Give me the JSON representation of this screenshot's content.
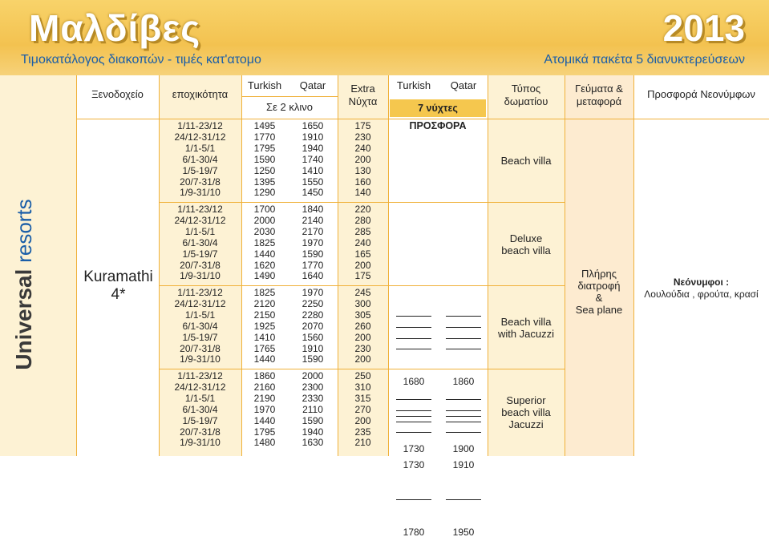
{
  "header": {
    "title": "Μαλδίβες",
    "year": "2013",
    "subtitle_left": "Τιμοκατάλογος διακοπών - τιμές κατ'ατομο",
    "subtitle_right": "Ατομικά πακέτα 5 διανυκτερεύσεων"
  },
  "side_title": {
    "main": "Universal",
    "rest": "resorts"
  },
  "columns": {
    "hotel": "Ξενοδοχείο",
    "season": "εποχικότητα",
    "turkish": "Turkish",
    "qatar": "Qatar",
    "double": "Σε 2 κλινο",
    "extra": "Extra\nΝύχτα",
    "offer_turkish": "Turkish",
    "offer_qatar": "Qatar",
    "offer_label": "7 νύχτες ΠΡΟΣΦΟΡΑ",
    "room_type": "Τύπος\nδωματίου",
    "meals": "Γεύματα &\nμεταφορά",
    "honeymoon": "Προσφορά Νεονύμφων"
  },
  "hotel": {
    "name": "Kuramathi\n4*"
  },
  "meals_value": "Πλήρης\nδιατροφή\n&\nSea plane",
  "honeymoon_value": {
    "title": "Νεόνυμφοι :",
    "text": "Λουλούδια , φρούτα, κρασί"
  },
  "room_groups": [
    {
      "room": "Beach villa",
      "seasons": "1/11-23/12\n24/12-31/12\n1/1-5/1\n6/1-30/4\n1/5-19/7\n20/7-31/8\n1/9-31/10",
      "turkish": "1495\n1770\n1795\n1590\n1250\n1395\n1290",
      "qatar": "1650\n1910\n1940\n1740\n1410\n1550\n1450",
      "extra": "175\n230\n240\n200\n130\n160\n140"
    },
    {
      "room": "Deluxe\nbeach villa",
      "seasons": "1/11-23/12\n24/12-31/12\n1/1-5/1\n6/1-30/4\n1/5-19/7\n20/7-31/8\n1/9-31/10",
      "turkish": "1700\n2000\n2030\n1825\n1440\n1620\n1490",
      "qatar": "1840\n2140\n2170\n1970\n1590\n1770\n1640",
      "extra": "220\n280\n285\n240\n165\n200\n175"
    },
    {
      "room": "Beach villa\nwith Jacuzzi",
      "seasons": "1/11-23/12\n24/12-31/12\n1/1-5/1\n6/1-30/4\n1/5-19/7\n20/7-31/8\n1/9-31/10",
      "turkish": "1825\n2120\n2150\n1925\n1410\n1765\n1440",
      "qatar": "1970\n2250\n2280\n2070\n1560\n1910\n1590",
      "extra": "245\n300\n305\n260\n200\n230\n200",
      "offer_turkish": [
        "",
        "",
        "",
        "",
        "1680",
        "",
        "1730"
      ],
      "offer_qatar": [
        "",
        "",
        "",
        "",
        "1860",
        "",
        "1900"
      ]
    },
    {
      "room": "Superior\nbeach villa\nJacuzzi",
      "seasons": "1/11-23/12\n24/12-31/12\n1/1-5/1\n6/1-30/4\n1/5-19/7\n20/7-31/8\n1/9-31/10",
      "turkish": "1860\n2160\n2190\n1970\n1440\n1795\n1480",
      "qatar": "2000\n2300\n2330\n2110\n1590\n1940\n1630",
      "extra": "250\n310\n315\n270\n200\n235\n210",
      "offer_turkish": [
        "",
        "",
        "",
        "",
        "1730",
        "",
        "1780"
      ],
      "offer_qatar": [
        "",
        "",
        "",
        "",
        "1910",
        "",
        "1950"
      ]
    }
  ]
}
